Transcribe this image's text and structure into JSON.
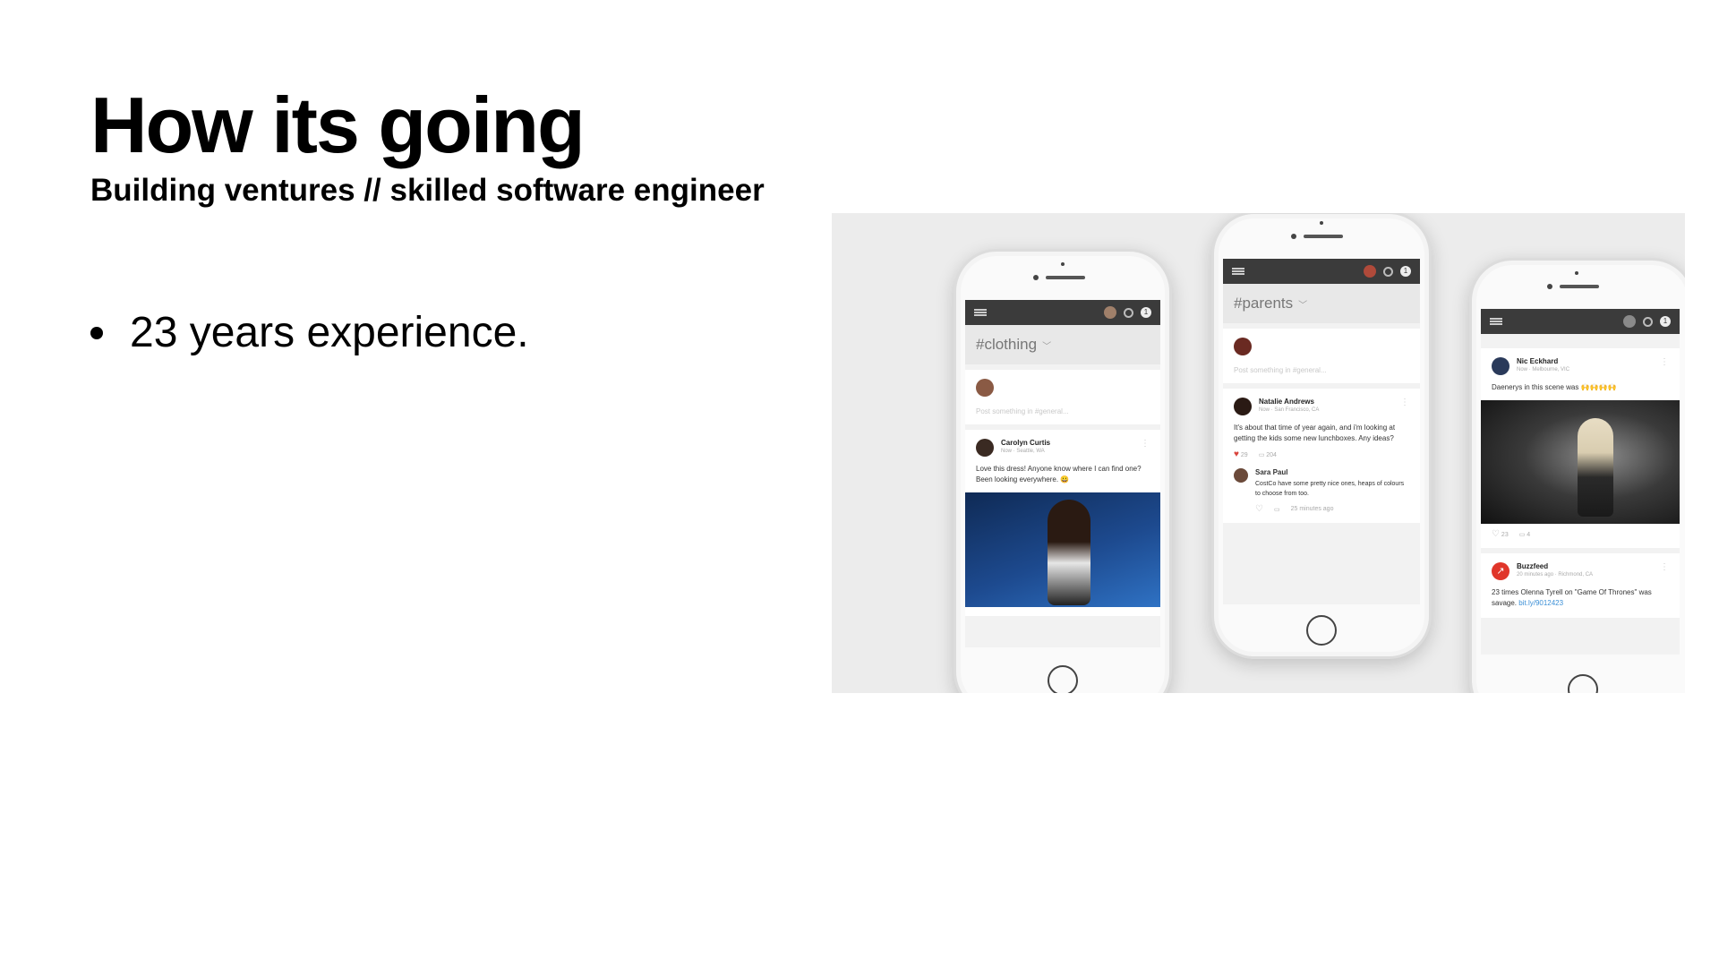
{
  "slide": {
    "title": "How its going",
    "subtitle": "Building ventures // skilled software engineer",
    "bullets": [
      "23 years experience."
    ]
  },
  "phones": {
    "left": {
      "channel": "#clothing",
      "compose_placeholder": "Post something in #general...",
      "post": {
        "author": "Carolyn Curtis",
        "meta": "Now · Seattle, WA",
        "text": "Love this dress! Anyone know where I can find one? Been looking everywhere. 😀"
      }
    },
    "middle": {
      "channel": "#parents",
      "compose_placeholder": "Post something in #general...",
      "post": {
        "author": "Natalie Andrews",
        "meta": "Now · San Francisco, CA",
        "text": "It's about that time of year again, and i'm looking at getting the kids some new lunchboxes. Any ideas?",
        "likes": "29",
        "comments": "204"
      },
      "reply": {
        "author": "Sara Paul",
        "text": "CostCo have some pretty nice ones, heaps of colours to choose from too.",
        "time": "25 minutes ago"
      }
    },
    "right": {
      "post": {
        "author": "Nic Eckhard",
        "meta": "Now · Melbourne, VIC",
        "text": "Daenerys in this scene was 🙌🙌🙌🙌",
        "likes": "23",
        "comments": "4"
      },
      "post2": {
        "author": "Buzzfeed",
        "meta": "20 minutes ago · Richmond, CA",
        "text": "23 times Olenna Tyrell on \"Game Of Thrones\" was savage.",
        "link": "bit.ly/9012423"
      }
    }
  },
  "colors": {
    "panel_bg": "#ececec",
    "topbar": "#3b3b3b",
    "heart": "#d9443c",
    "link": "#3b8fd6",
    "buzzfeed": "#e0362a"
  }
}
